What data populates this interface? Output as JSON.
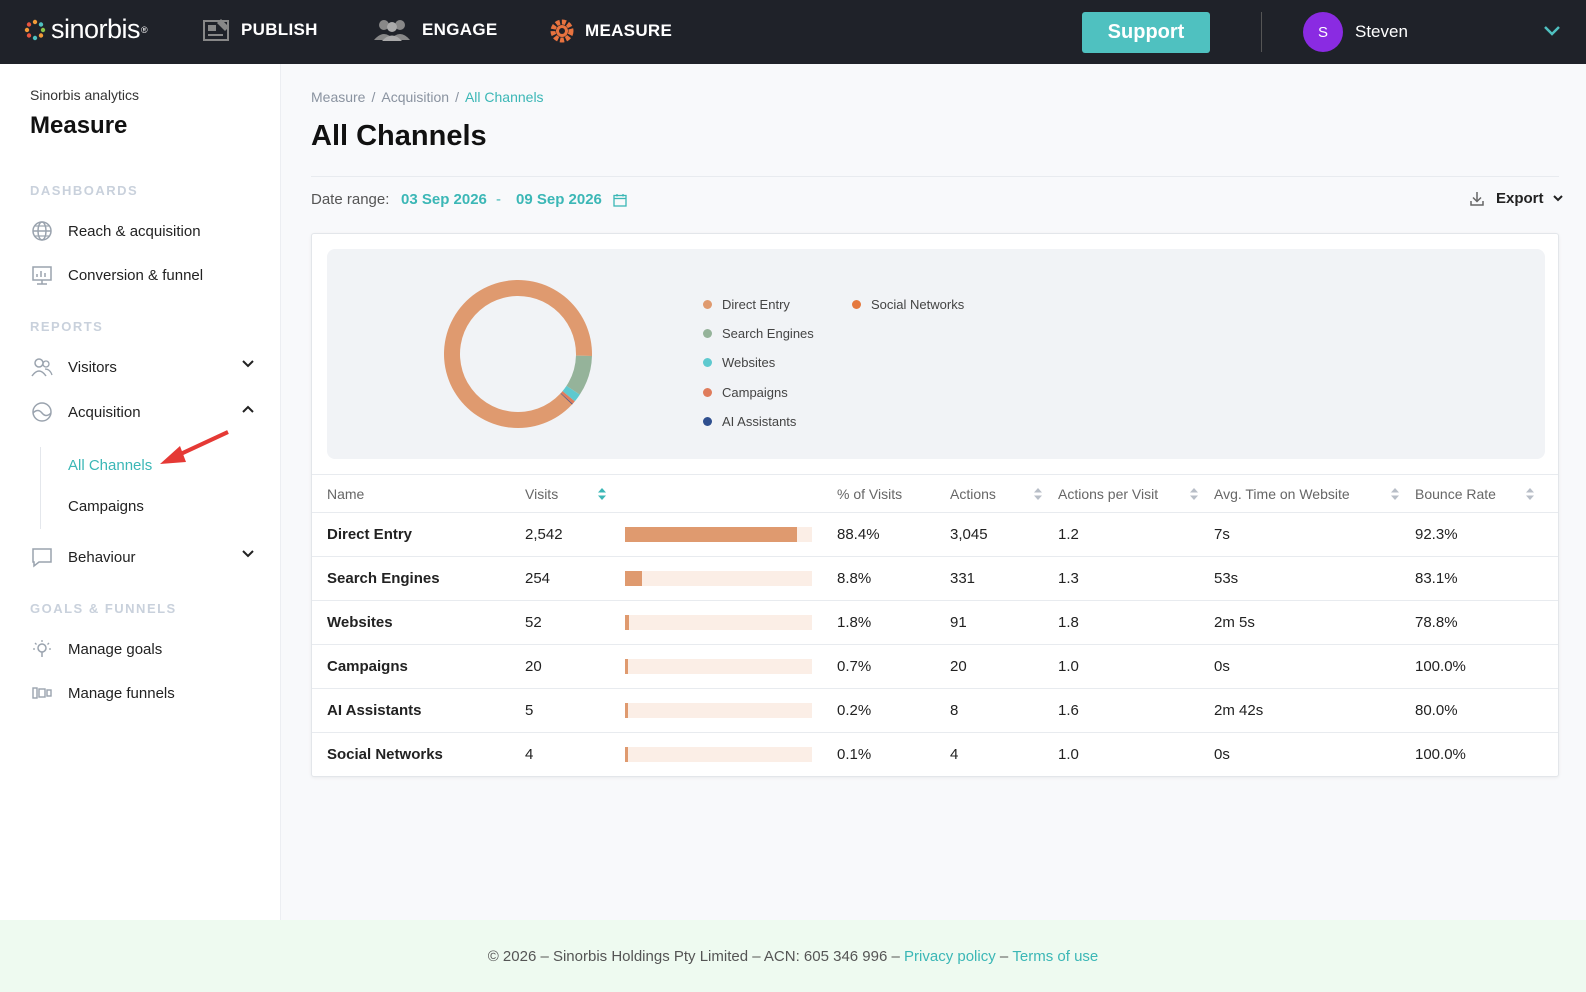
{
  "app": {
    "logo_text": "sinorbis",
    "nav": {
      "publish": "PUBLISH",
      "engage": "ENGAGE",
      "measure": "MEASURE"
    },
    "support_label": "Support",
    "user": {
      "initial": "S",
      "name": "Steven"
    }
  },
  "sidebar": {
    "subtitle": "Sinorbis analytics",
    "title": "Measure",
    "sections": {
      "dashboards": "DASHBOARDS",
      "reports": "REPORTS",
      "goals": "GOALS & FUNNELS"
    },
    "items": {
      "reach": "Reach & acquisition",
      "conversion": "Conversion & funnel",
      "visitors": "Visitors",
      "acquisition": "Acquisition",
      "all_channels": "All Channels",
      "campaigns": "Campaigns",
      "behaviour": "Behaviour",
      "manage_goals": "Manage goals",
      "manage_funnels": "Manage funnels"
    }
  },
  "breadcrumb": [
    "Measure",
    "Acquisition",
    "All Channels"
  ],
  "page_title": "All Channels",
  "date_range": {
    "label": "Date range:",
    "start": "03 Sep 2026",
    "sep": "-",
    "end": "09 Sep 2026"
  },
  "export_label": "Export",
  "chart_data": {
    "type": "pie",
    "categories": [
      "Direct Entry",
      "Search Engines",
      "Websites",
      "Campaigns",
      "AI Assistants",
      "Social Networks"
    ],
    "values": [
      2542,
      254,
      52,
      20,
      5,
      4
    ],
    "colors": [
      "#df9a6f",
      "#95b39a",
      "#5ec9cf",
      "#df7c5c",
      "#2f4f8f",
      "#e5793f"
    ],
    "legend_position": "right"
  },
  "table": {
    "headers": {
      "name": "Name",
      "visits": "Visits",
      "pct": "% of Visits",
      "actions": "Actions",
      "apv": "Actions per Visit",
      "avg_time": "Avg. Time on Website",
      "bounce": "Bounce Rate"
    },
    "rows": [
      {
        "name": "Direct Entry",
        "visits": "2,542",
        "share": 0.884,
        "pct": "88.4%",
        "actions": "3,045",
        "apv": "1.2",
        "avg_time": "7s",
        "bounce": "92.3%"
      },
      {
        "name": "Search Engines",
        "visits": "254",
        "share": 0.088,
        "pct": "8.8%",
        "actions": "331",
        "apv": "1.3",
        "avg_time": "53s",
        "bounce": "83.1%"
      },
      {
        "name": "Websites",
        "visits": "52",
        "share": 0.018,
        "pct": "1.8%",
        "actions": "91",
        "apv": "1.8",
        "avg_time": "2m 5s",
        "bounce": "78.8%"
      },
      {
        "name": "Campaigns",
        "visits": "20",
        "share": 0.007,
        "pct": "0.7%",
        "actions": "20",
        "apv": "1.0",
        "avg_time": "0s",
        "bounce": "100.0%"
      },
      {
        "name": "AI Assistants",
        "visits": "5",
        "share": 0.002,
        "pct": "0.2%",
        "actions": "8",
        "apv": "1.6",
        "avg_time": "2m 42s",
        "bounce": "80.0%"
      },
      {
        "name": "Social Networks",
        "visits": "4",
        "share": 0.001,
        "pct": "0.1%",
        "actions": "4",
        "apv": "1.0",
        "avg_time": "0s",
        "bounce": "100.0%"
      }
    ]
  },
  "footer": {
    "copyright": "© 2026 – Sinorbis Holdings Pty Limited – ACN: 605 346 996 –",
    "privacy": "Privacy policy",
    "dash": "–",
    "terms": "Terms of use"
  }
}
